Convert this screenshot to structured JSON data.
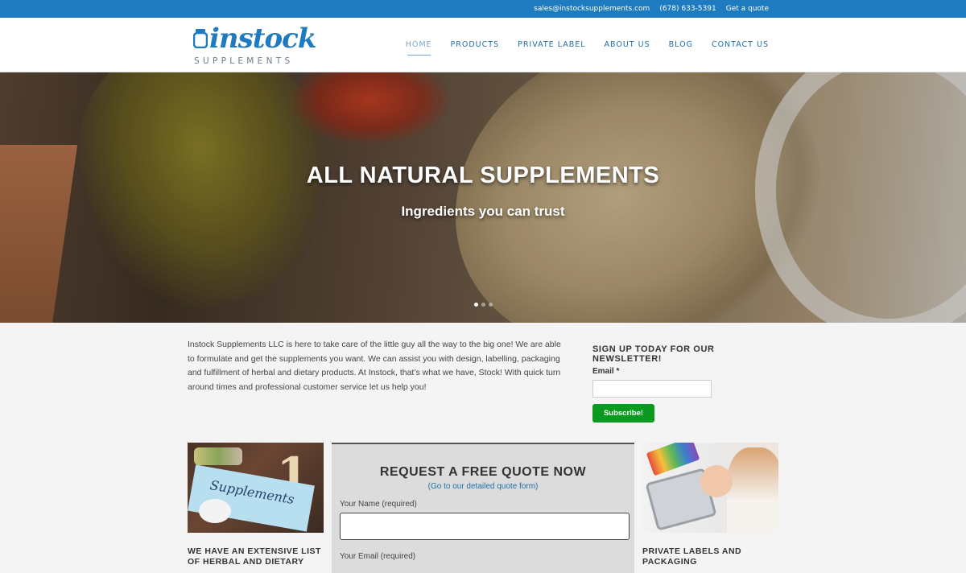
{
  "topbar": {
    "email": "sales@instocksupplements.com",
    "phone": "(678) 633-5391",
    "quote_link": "Get a quote"
  },
  "logo": {
    "word": "instock",
    "sub": "SUPPLEMENTS"
  },
  "nav": {
    "items": [
      {
        "label": "HOME",
        "active": true
      },
      {
        "label": "PRODUCTS"
      },
      {
        "label": "PRIVATE LABEL"
      },
      {
        "label": "ABOUT US"
      },
      {
        "label": "BLOG"
      },
      {
        "label": "CONTACT US"
      }
    ]
  },
  "hero": {
    "title": "ALL NATURAL SUPPLEMENTS",
    "subtitle": "Ingredients you can trust",
    "slides": 3,
    "active_slide": 1
  },
  "intro": {
    "text": "Instock Supplements LLC is here to take care of the little guy all the way to the big one! We are able to formulate and get the supplements you want. We can assist you with design, labelling, packaging and fulfillment of herbal and dietary products. At Instock, that’s what we have, Stock! With quick turn around times and professional customer service let us help you!"
  },
  "newsletter": {
    "title": "SIGN UP TODAY FOR OUR NEWSLETTER!",
    "email_label": "Email *",
    "email_value": "",
    "button": "Subscribe!"
  },
  "cards": {
    "left_title": "WE HAVE AN EXTENSIVE LIST OF HERBAL AND DIETARY",
    "left_image_text": "Supplements",
    "right_title": "PRIVATE LABELS AND PACKAGING"
  },
  "quote_form": {
    "title": "REQUEST A FREE QUOTE NOW",
    "link": "(Go to our detailed quote form)",
    "name_label": "Your Name (required)",
    "name_value": "",
    "email_label": "Your Email (required)"
  },
  "colors": {
    "brand_blue": "#1f7bbf",
    "subscribe_green": "#0a9a1f"
  }
}
